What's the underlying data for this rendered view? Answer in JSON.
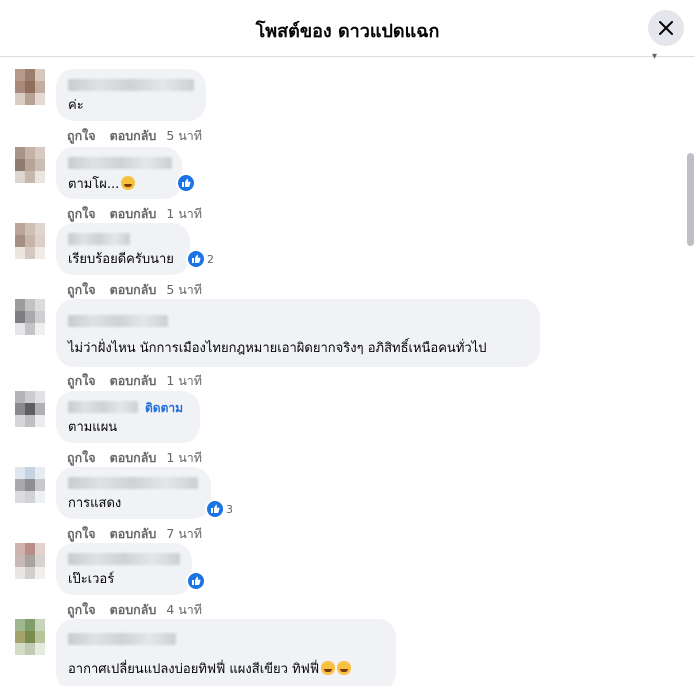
{
  "header": {
    "title": "โพสต์ของ ดาวแปดแฉก",
    "close_icon": "close-icon"
  },
  "comments": [
    {
      "text": "ค่ะ",
      "like": "ถูกใจ",
      "reply": "ตอบกลับ",
      "time": "5 นาที"
    },
    {
      "text": "ตามโผ...",
      "like": "ถูกใจ",
      "reply": "ตอบกลับ",
      "time": "1 นาที",
      "reaction": {
        "icon": "like-icon"
      }
    },
    {
      "text": "เรียบร้อยดีครับนาย",
      "like": "ถูกใจ",
      "reply": "ตอบกลับ",
      "time": "5 นาที",
      "reaction": {
        "icon": "like-icon",
        "count": "2"
      }
    },
    {
      "text": "ไม่ว่าฝั่งไหน นักการเมืองไทยกฎหมายเอาผิดยากจริงๆ อภิสิทธิ์เหนือคนทั่วไป",
      "like": "ถูกใจ",
      "reply": "ตอบกลับ",
      "time": "1 นาที"
    },
    {
      "text": "ตามแผน",
      "follow": "ติดตาม",
      "like": "ถูกใจ",
      "reply": "ตอบกลับ",
      "time": "1 นาที"
    },
    {
      "text": "การแสดง",
      "like": "ถูกใจ",
      "reply": "ตอบกลับ",
      "time": "7 นาที",
      "reaction": {
        "icon": "like-icon",
        "count": "3"
      }
    },
    {
      "text": "เป๊ะเวอร์",
      "like": "ถูกใจ",
      "reply": "ตอบกลับ",
      "time": "4 นาที",
      "reaction": {
        "icon": "like-icon"
      }
    },
    {
      "text": "อากาศเปลี่ยนแปลงบ่อยทิฟฟี่ แผงสีเขียว ทิฟฟี่"
    }
  ],
  "colors": {
    "accent": "#1b74e4",
    "bubble": "#f0f2f5",
    "meta": "#65676b"
  }
}
